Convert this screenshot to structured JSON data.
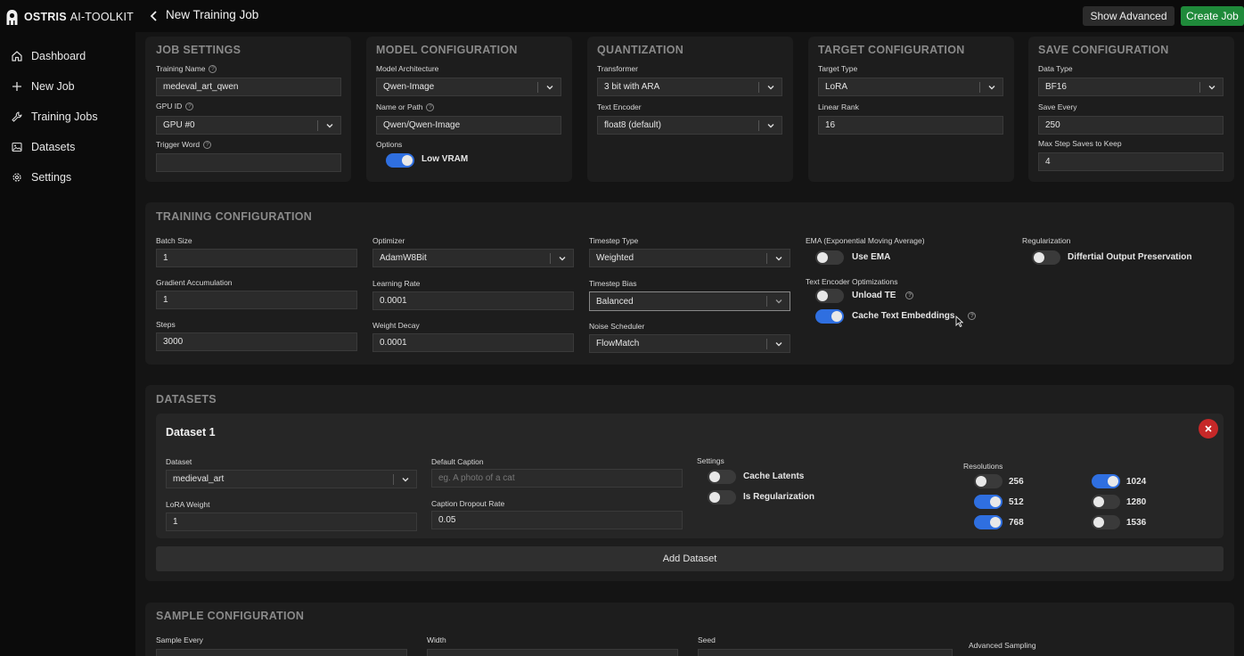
{
  "brand": {
    "bold": "OSTRIS",
    "light": "AI-TOOLKIT"
  },
  "sidebar": {
    "items": [
      {
        "label": "Dashboard",
        "icon": "home-icon"
      },
      {
        "label": "New Job",
        "icon": "plus-icon"
      },
      {
        "label": "Training Jobs",
        "icon": "tools-icon"
      },
      {
        "label": "Datasets",
        "icon": "image-icon"
      },
      {
        "label": "Settings",
        "icon": "gear-icon"
      }
    ]
  },
  "header": {
    "title": "New Training Job",
    "show_advanced": "Show Advanced",
    "create_job": "Create Job"
  },
  "job_settings": {
    "title": "JOB SETTINGS",
    "training_name_label": "Training Name",
    "training_name": "medeval_art_qwen",
    "gpu_label": "GPU ID",
    "gpu": "GPU #0",
    "trigger_label": "Trigger Word",
    "trigger": ""
  },
  "model_config": {
    "title": "MODEL CONFIGURATION",
    "arch_label": "Model Architecture",
    "arch": "Qwen-Image",
    "path_label": "Name or Path",
    "path": "Qwen/Qwen-Image",
    "options_label": "Options",
    "low_vram_label": "Low VRAM",
    "low_vram": true
  },
  "quantization": {
    "title": "QUANTIZATION",
    "transformer_label": "Transformer",
    "transformer": "3 bit with ARA",
    "text_encoder_label": "Text Encoder",
    "text_encoder": "float8 (default)"
  },
  "target_config": {
    "title": "TARGET CONFIGURATION",
    "type_label": "Target Type",
    "type": "LoRA",
    "rank_label": "Linear Rank",
    "rank": "16"
  },
  "save_config": {
    "title": "SAVE CONFIGURATION",
    "dtype_label": "Data Type",
    "dtype": "BF16",
    "every_label": "Save Every",
    "every": "250",
    "max_label": "Max Step Saves to Keep",
    "max": "4"
  },
  "training": {
    "title": "TRAINING CONFIGURATION",
    "batch_label": "Batch Size",
    "batch": "1",
    "grad_label": "Gradient Accumulation",
    "grad": "1",
    "steps_label": "Steps",
    "steps": "3000",
    "optimizer_label": "Optimizer",
    "optimizer": "AdamW8Bit",
    "lr_label": "Learning Rate",
    "lr": "0.0001",
    "wd_label": "Weight Decay",
    "wd": "0.0001",
    "ts_type_label": "Timestep Type",
    "ts_type": "Weighted",
    "ts_bias_label": "Timestep Bias",
    "ts_bias": "Balanced",
    "noise_label": "Noise Scheduler",
    "noise": "FlowMatch",
    "ema_label": "EMA (Exponential Moving Average)",
    "use_ema_label": "Use EMA",
    "use_ema": false,
    "te_opt_label": "Text Encoder Optimizations",
    "unload_te_label": "Unload TE",
    "unload_te": false,
    "cache_te_label": "Cache Text Embeddings",
    "cache_te": true,
    "reg_label": "Regularization",
    "dop_label": "Differtial Output Preservation",
    "dop": false
  },
  "datasets": {
    "title": "DATASETS",
    "items": [
      {
        "title": "Dataset 1",
        "dataset_label": "Dataset",
        "dataset": "medieval_art",
        "lora_weight_label": "LoRA Weight",
        "lora_weight": "1",
        "caption_label": "Default Caption",
        "caption_placeholder": "eg. A photo of a cat",
        "dropout_label": "Caption Dropout Rate",
        "dropout": "0.05",
        "settings_label": "Settings",
        "cache_latents_label": "Cache Latents",
        "cache_latents": false,
        "is_reg_label": "Is Regularization",
        "is_reg": false,
        "resolutions_label": "Resolutions",
        "resolutions": [
          {
            "label": "256",
            "on": false
          },
          {
            "label": "512",
            "on": true
          },
          {
            "label": "768",
            "on": true
          },
          {
            "label": "1024",
            "on": true
          },
          {
            "label": "1280",
            "on": false
          },
          {
            "label": "1536",
            "on": false
          }
        ]
      }
    ],
    "add_label": "Add Dataset"
  },
  "sample": {
    "title": "SAMPLE CONFIGURATION",
    "every_label": "Sample Every",
    "width_label": "Width",
    "seed_label": "Seed",
    "advanced_label": "Advanced Sampling"
  },
  "colors": {
    "accent": "#2f6fe0",
    "create": "#1f8a3a",
    "danger": "#c62828"
  }
}
